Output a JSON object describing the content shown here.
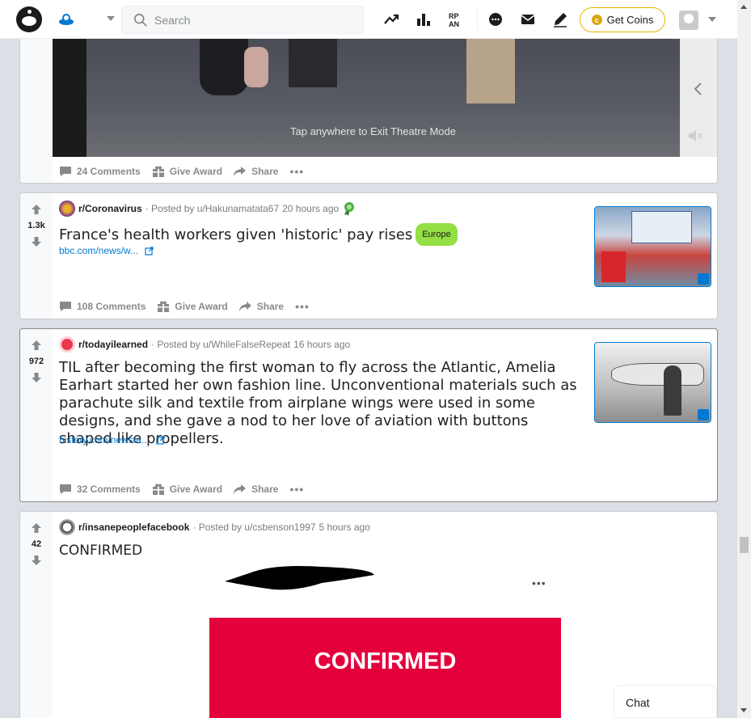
{
  "header": {
    "search_placeholder": "Search",
    "get_coins_label": "Get Coins"
  },
  "video_post": {
    "overlay_text": "Tap anywhere to Exit Theatre Mode",
    "actions": {
      "comments": "24 Comments",
      "award": "Give Award",
      "share": "Share"
    }
  },
  "posts": [
    {
      "votes": "1.3k",
      "subreddit": "r/Coronavirus",
      "posted_by": "· Posted by u/Hakunamatata67",
      "time": "20 hours ago",
      "title": "France's health workers given 'historic' pay rises",
      "flair": "Europe",
      "link": "bbc.com/news/w...",
      "actions": {
        "comments": "108 Comments",
        "award": "Give Award",
        "share": "Share"
      }
    },
    {
      "votes": "972",
      "subreddit": "r/todayilearned",
      "posted_by": "· Posted by u/WhileFalseRepeat",
      "time": "16 hours ago",
      "title": "TIL after becoming the first woman to fly across the Atlantic, Amelia Earhart started her own fashion line. Unconventional materials such as parachute silk and textile from airplane wings were used in some designs, and she gave a nod to her love of aviation with buttons shaped like propellers.",
      "link": "history.com/news/a...",
      "actions": {
        "comments": "32 Comments",
        "award": "Give Award",
        "share": "Share"
      }
    },
    {
      "votes": "42",
      "subreddit": "r/insanepeoplefacebook",
      "posted_by": "· Posted by u/csbenson1997",
      "time": "5 hours ago",
      "title": "CONFIRMED",
      "image_text": "CONFIRMED"
    }
  ],
  "chat_label": "Chat",
  "colors": {
    "accent": "#0079d3",
    "upvote": "#878a8c",
    "flair": "#94e044",
    "banner": "#e4003b"
  }
}
